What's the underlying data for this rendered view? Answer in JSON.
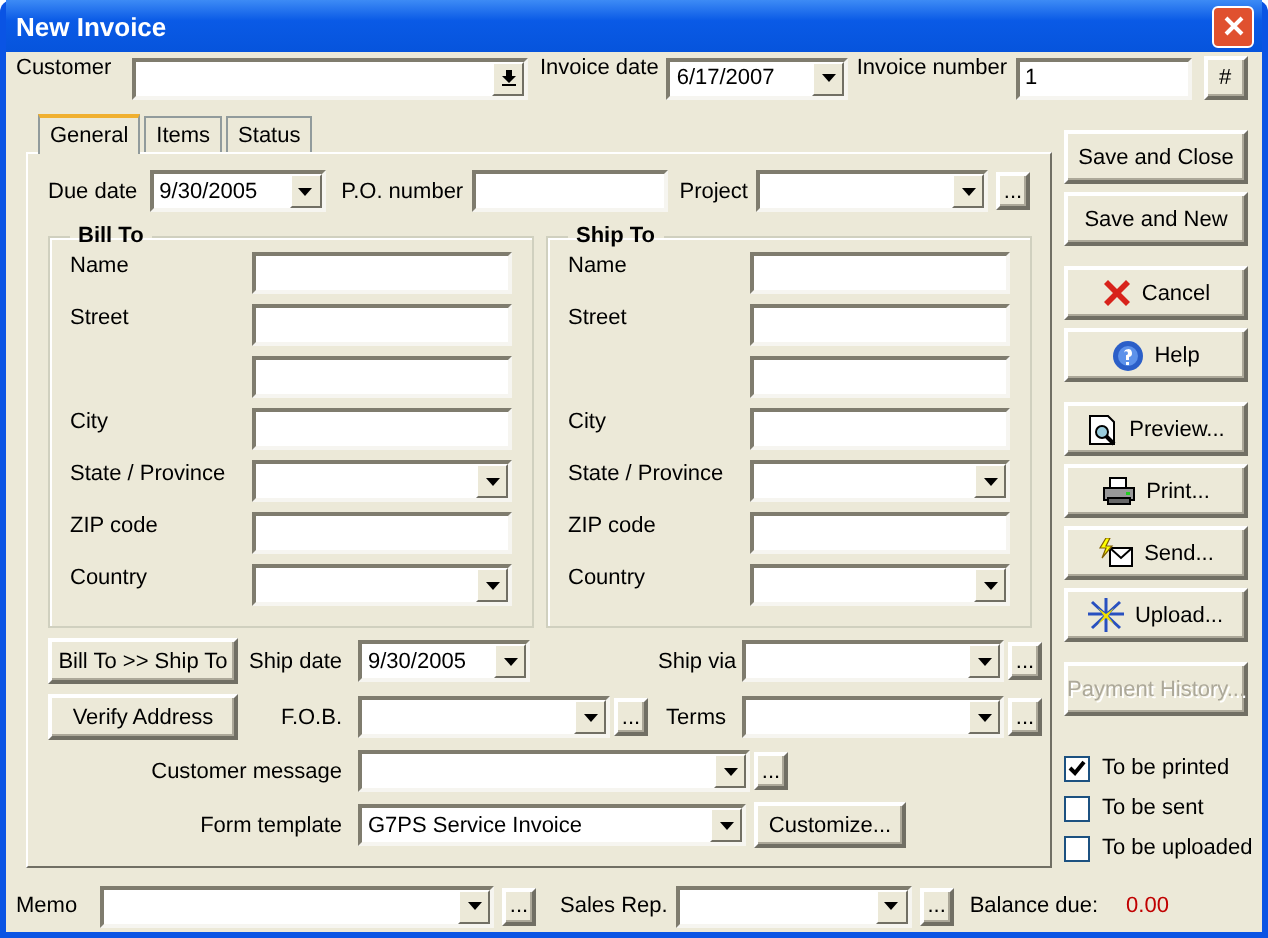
{
  "window": {
    "title": "New Invoice"
  },
  "header": {
    "customer": {
      "label": "Customer"
    },
    "invoice_date": {
      "label": "Invoice date",
      "value": "6/17/2007"
    },
    "invoice_number": {
      "label": "Invoice number",
      "value": "1",
      "button": "#"
    }
  },
  "tabs": [
    {
      "label": "General",
      "selected": true
    },
    {
      "label": "Items",
      "selected": false
    },
    {
      "label": "Status",
      "selected": false
    }
  ],
  "general": {
    "due_date": {
      "label": "Due date",
      "value": "9/30/2005"
    },
    "po_number": {
      "label": "P.O. number"
    },
    "project": {
      "label": "Project",
      "browse": "..."
    },
    "bill_to": {
      "title": "Bill To",
      "rows": [
        {
          "label": "Name",
          "kind": "text"
        },
        {
          "label": "Street",
          "kind": "text"
        },
        {
          "kind": "text"
        },
        {
          "label": "City",
          "kind": "text"
        },
        {
          "label": "State / Province",
          "kind": "dropdown"
        },
        {
          "label": "ZIP code",
          "kind": "text"
        },
        {
          "label": "Country",
          "kind": "dropdown"
        }
      ]
    },
    "ship_to": {
      "title": "Ship To",
      "rows": [
        {
          "label": "Name",
          "kind": "text"
        },
        {
          "label": "Street",
          "kind": "text"
        },
        {
          "kind": "text"
        },
        {
          "label": "City",
          "kind": "text"
        },
        {
          "label": "State / Province",
          "kind": "dropdown"
        },
        {
          "label": "ZIP code",
          "kind": "text"
        },
        {
          "label": "Country",
          "kind": "dropdown"
        }
      ]
    },
    "copy_button": "Bill To >> Ship To",
    "verify_button": "Verify Address",
    "ship_date": {
      "label": "Ship date",
      "value": "9/30/2005"
    },
    "ship_via": {
      "label": "Ship via",
      "browse": "..."
    },
    "fob": {
      "label": "F.O.B.",
      "browse": "..."
    },
    "terms": {
      "label": "Terms",
      "browse": "..."
    },
    "customer_message": {
      "label": "Customer message",
      "browse": "..."
    },
    "form_template": {
      "label": "Form template",
      "value": "G7PS Service Invoice",
      "button": "Customize..."
    }
  },
  "actions": [
    {
      "label": "Save and Close",
      "kind": "plain",
      "disabled": false
    },
    {
      "label": "Save and New",
      "kind": "plain",
      "disabled": false
    },
    {
      "label": "Cancel",
      "kind": "cancel",
      "disabled": false
    },
    {
      "label": "Help",
      "kind": "help",
      "disabled": false
    },
    {
      "label": "Preview...",
      "kind": "preview",
      "disabled": false
    },
    {
      "label": "Print...",
      "kind": "print",
      "disabled": false
    },
    {
      "label": "Send...",
      "kind": "send",
      "disabled": false
    },
    {
      "label": "Upload...",
      "kind": "upload",
      "disabled": false
    },
    {
      "label": "Payment History...",
      "kind": "plain",
      "disabled": true
    }
  ],
  "options": [
    {
      "label": "To be printed",
      "checked": true
    },
    {
      "label": "To be sent",
      "checked": false
    },
    {
      "label": "To be uploaded",
      "checked": false
    }
  ],
  "footer": {
    "memo": {
      "label": "Memo",
      "browse": "..."
    },
    "sales_rep": {
      "label": "Sales Rep.",
      "browse": "..."
    },
    "balance_due": {
      "label": "Balance due:",
      "value": "0.00"
    }
  }
}
